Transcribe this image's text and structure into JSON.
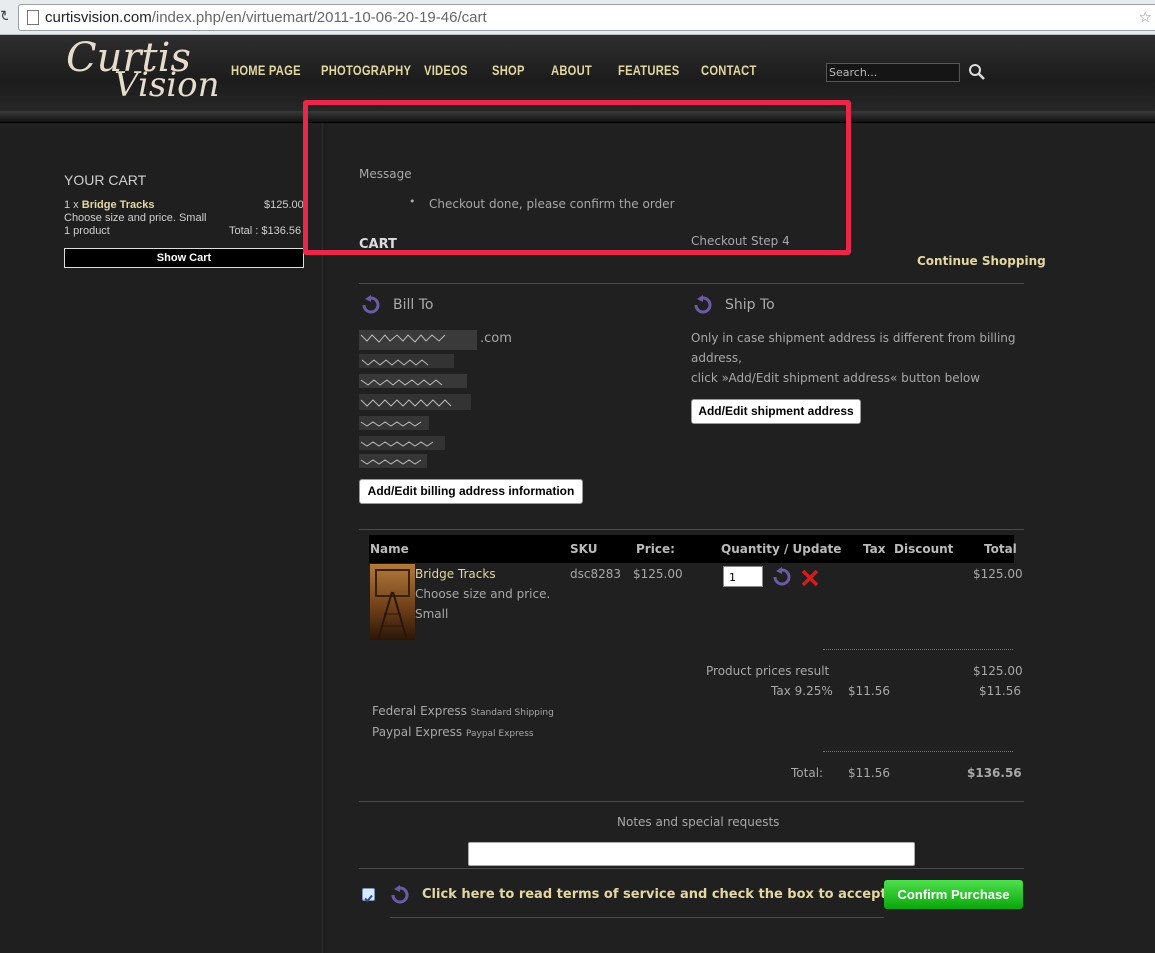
{
  "browser": {
    "url_domain": "curtisvision.com",
    "url_path": "/index.php/en/virtuemart/2011-10-06-20-19-46/cart"
  },
  "logo": {
    "line1": "Curtis",
    "line2": "Vision"
  },
  "nav": [
    "HOME PAGE",
    "PHOTOGRAPHY",
    "VIDEOS",
    "SHOP",
    "ABOUT",
    "FEATURES",
    "CONTACT"
  ],
  "search": {
    "placeholder": "Search..."
  },
  "sidebar": {
    "title": "YOUR CART",
    "qty_prefix": "1 x",
    "item_name": "Bridge Tracks",
    "item_price": "$125.00",
    "item_desc": "Choose size and price. Small",
    "product_count": "1 product",
    "total": "Total : $136.56",
    "show_cart": "Show Cart"
  },
  "message": {
    "label": "Message",
    "text": "Checkout done, please confirm the order"
  },
  "cart_heading": "CART",
  "checkout_step": "Checkout Step 4",
  "continue_shopping": "Continue Shopping",
  "bill_to": {
    "title": "Bill To",
    "email_suffix": ".com",
    "button": "Add/Edit billing address information"
  },
  "ship_to": {
    "title": "Ship To",
    "line1": "Only in case shipment address is different from billing",
    "line2": "address,",
    "line3": "click »Add/Edit shipment address« button below",
    "button": "Add/Edit shipment address"
  },
  "table": {
    "headers": {
      "name": "Name",
      "sku": "SKU",
      "price": "Price:",
      "quantity": "Quantity / Update",
      "tax": "Tax",
      "discount": "Discount",
      "total": "Total"
    },
    "row": {
      "name": "Bridge Tracks",
      "desc1": "Choose size and price.",
      "desc2": "Small",
      "sku": "dsc8283",
      "price": "$125.00",
      "quantity": "1",
      "total": "$125.00"
    }
  },
  "summary": {
    "product_prices_label": "Product prices result",
    "product_prices_value": "$125.00",
    "tax_label": "Tax 9.25%",
    "tax_amount": "$11.56",
    "tax_total": "$11.56",
    "shipping_name": "Federal Express",
    "shipping_desc": "Standard Shipping",
    "payment_name": "Paypal Express",
    "payment_desc": "Paypal Express",
    "total_label": "Total:",
    "total_tax": "$11.56",
    "total_value": "$136.56"
  },
  "notes_label": "Notes and special requests",
  "terms_text": "Click here to read terms of service and check the box to accept them.",
  "confirm_button": "Confirm Purchase",
  "colors": {
    "accent_gold": "#e4d7a2",
    "highlight_red": "#e8274a",
    "confirm_green": "#1fbf1f",
    "undo_purple": "#6b5aa6"
  }
}
